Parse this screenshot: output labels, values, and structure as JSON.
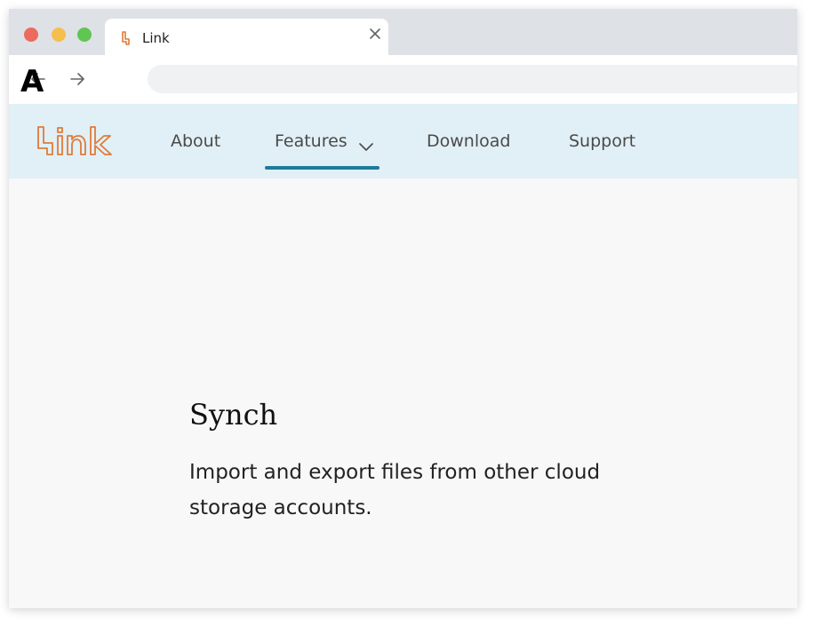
{
  "browser": {
    "tab_title": "Link",
    "address": ""
  },
  "annotation": {
    "label": "A"
  },
  "site": {
    "logo_text": "Link",
    "nav": {
      "about": "About",
      "features": "Features",
      "download": "Download",
      "support": "Support"
    },
    "active_nav": "Features"
  },
  "content": {
    "title": "Synch",
    "body": "Import and export files from other cloud storage accounts."
  },
  "colors": {
    "brand": "#e07b39",
    "nav_background": "#e1f0f6",
    "active_underline": "#1e7a99",
    "traffic_red": "#ed6a5e",
    "traffic_yellow": "#f5bf4f",
    "traffic_green": "#61c554"
  },
  "icons": [
    "close-icon",
    "back-icon",
    "forward-icon",
    "chevron-down-icon",
    "link-favicon-icon"
  ]
}
